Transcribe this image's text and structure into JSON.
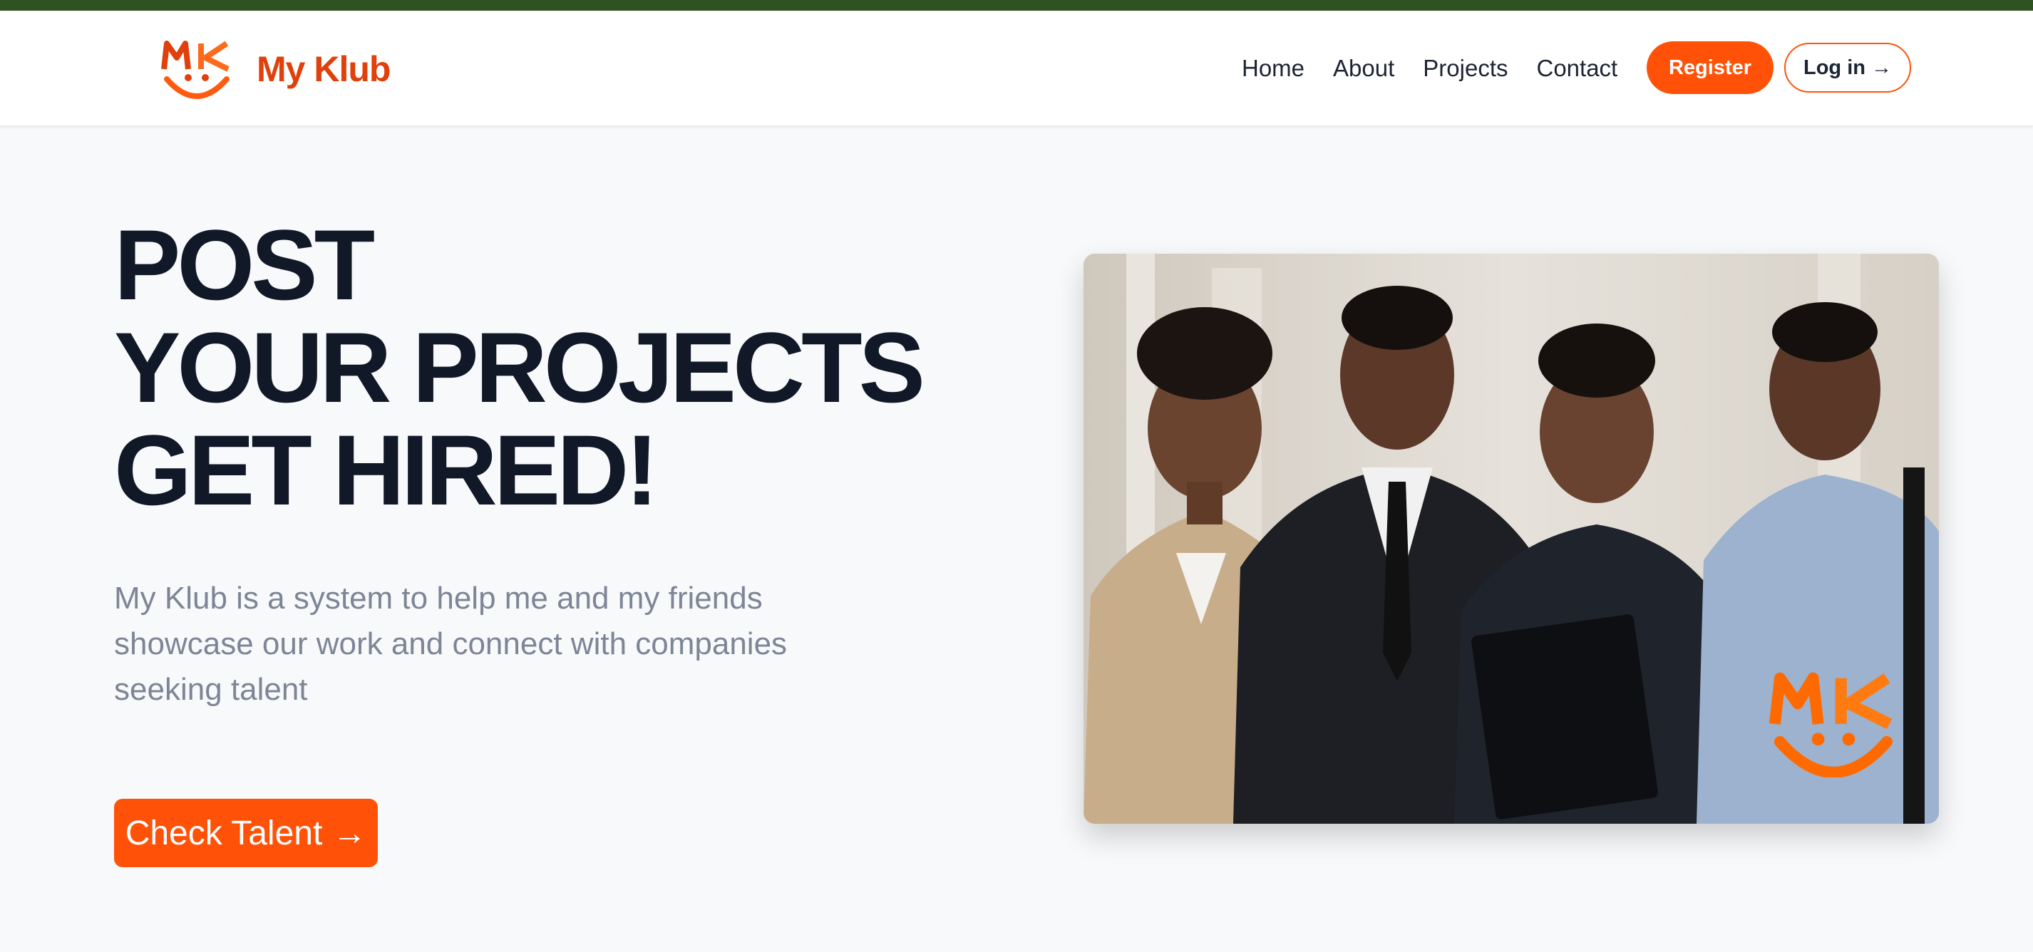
{
  "brand": {
    "name": "My Klub",
    "logo_icon": "mk-smiley-logo-icon",
    "color": "#e0400b"
  },
  "nav": {
    "links": [
      "Home",
      "About",
      "Projects",
      "Contact"
    ],
    "register_label": "Register",
    "login_label": "Log in",
    "login_arrow": "→"
  },
  "hero": {
    "title_lines": [
      "POST",
      "YOUR PROJECTS",
      "GET HIRED!"
    ],
    "description": "My Klub is a system to help me and my friends showcase our work and connect with companies seeking talent",
    "cta_label": "Check Talent",
    "cta_arrow": "→"
  },
  "image": {
    "watermark_icon": "mk-smiley-logo-icon"
  },
  "colors": {
    "accent": "#ff5208",
    "topbar": "#2e5320",
    "title": "#111827",
    "body_text": "#7d8596"
  }
}
